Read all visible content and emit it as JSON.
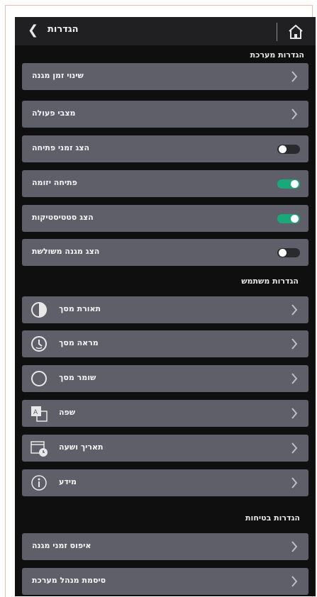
{
  "header": {
    "title": "הגדרות",
    "back_icon": "chevron-left-icon",
    "home_icon": "home-icon"
  },
  "sections": {
    "system": "הגדרות מערכת",
    "user": "הגדרות משתמש",
    "security": "הגדרות בטיחות"
  },
  "system_items": [
    {
      "label": "שינוי זמן מגנה",
      "control": "chevron"
    },
    {
      "label": "מצבי פעולה",
      "control": "chevron"
    },
    {
      "label": "הצג זמני פתיחה",
      "control": "toggle",
      "on": false
    },
    {
      "label": "פתיחה יזומה",
      "control": "toggle",
      "on": true
    },
    {
      "label": "הצג סטטיסטיקות",
      "control": "toggle",
      "on": true
    },
    {
      "label": "הצג מגנה משולשת",
      "control": "toggle",
      "on": false
    }
  ],
  "user_items": [
    {
      "label": "תאורת מסך",
      "icon": "brightness-icon"
    },
    {
      "label": "מראה מסך",
      "icon": "screen-timeout-icon"
    },
    {
      "label": "שומר מסך",
      "icon": "moon-icon"
    },
    {
      "label": "שפה",
      "icon": "language-icon"
    },
    {
      "label": "תאריך ושעה",
      "icon": "date-time-icon"
    },
    {
      "label": "מידע",
      "icon": "info-icon"
    }
  ],
  "security_items": [
    {
      "label": "איפוס זמני מגנה"
    },
    {
      "label": "סיסמת מנהל מערכת"
    }
  ],
  "colors": {
    "screen_bg": "#0f0f10",
    "row_bg": "#5f5f69",
    "toggle_on": "#1aa87a",
    "frame_border": "#f0b8b8"
  }
}
